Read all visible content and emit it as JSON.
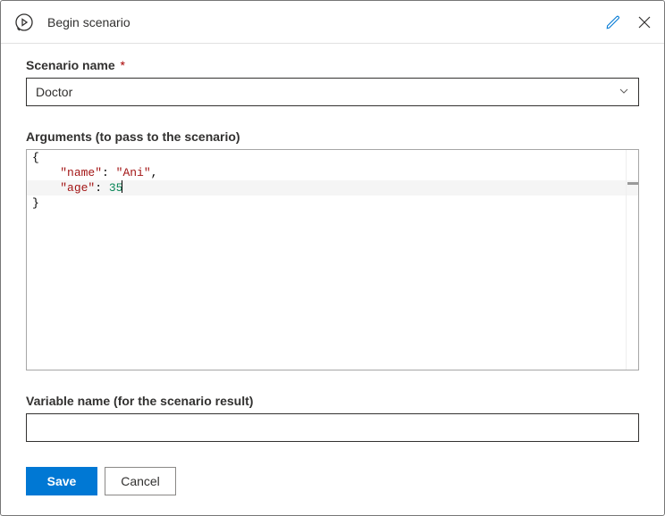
{
  "header": {
    "title": "Begin scenario"
  },
  "fields": {
    "scenarioName": {
      "label": "Scenario name",
      "required": "*",
      "value": "Doctor"
    },
    "arguments": {
      "label": "Arguments (to pass to the scenario)",
      "code": {
        "line1": "{",
        "line2_indent": "    ",
        "line2_key": "\"name\"",
        "line2_sep": ": ",
        "line2_val": "\"Ani\"",
        "line2_end": ",",
        "line3_indent": "    ",
        "line3_key": "\"age\"",
        "line3_sep": ": ",
        "line3_val": "35",
        "line4": "}"
      }
    },
    "variableName": {
      "label": "Variable name (for the scenario result)",
      "value": ""
    }
  },
  "footer": {
    "save": "Save",
    "cancel": "Cancel"
  }
}
